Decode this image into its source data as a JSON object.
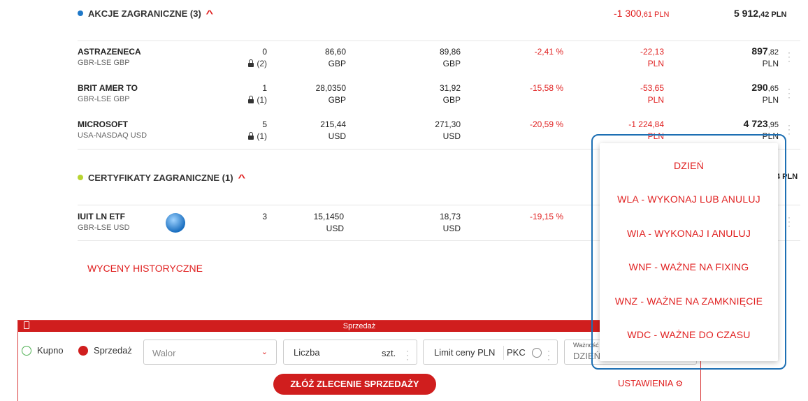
{
  "sections": {
    "foreign_stocks": {
      "title": "AKCJE ZAGRANICZNE (3)",
      "profit_main": "-1 300",
      "profit_dec": ",61 PLN",
      "value_main": "5 912",
      "value_dec": ",42 PLN",
      "dot_color": "#1e78c8"
    },
    "foreign_certs": {
      "title": "CERTYFIKATY ZAGRANICZNE (1)",
      "value_partial": "4 PLN",
      "dot_color": "#b8d430"
    }
  },
  "rows": [
    {
      "name": "ASTRAZENECA",
      "market": "GBR-LSE GBP",
      "qty": "0",
      "blocked": "(2)",
      "price": "86,60",
      "price_cur": "GBP",
      "cur_price": "89,86",
      "cur_cur": "GBP",
      "pct": "-2,41 %",
      "pl": "-22,13",
      "pl_cur": "PLN",
      "val_main": "897",
      "val_dec": ",82",
      "val_cur": "PLN"
    },
    {
      "name": "BRIT AMER TO",
      "market": "GBR-LSE GBP",
      "qty": "1",
      "blocked": "(1)",
      "price": "28,0350",
      "price_cur": "GBP",
      "cur_price": "31,92",
      "cur_cur": "GBP",
      "pct": "-15,58 %",
      "pl": "-53,65",
      "pl_cur": "PLN",
      "val_main": "290",
      "val_dec": ",65",
      "val_cur": "PLN"
    },
    {
      "name": "MICROSOFT",
      "market": "USA-NASDAQ USD",
      "qty": "5",
      "blocked": "(1)",
      "price": "215,44",
      "price_cur": "USD",
      "cur_price": "271,30",
      "cur_cur": "USD",
      "pct": "-20,59 %",
      "pl": "-1 224,84",
      "pl_cur": "PLN",
      "val_main": "4 723",
      "val_dec": ",95",
      "val_cur": "PLN"
    }
  ],
  "cert_row": {
    "name": "IUIT LN ETF",
    "market": "GBR-LSE USD",
    "qty": "3",
    "price": "15,1450",
    "price_cur": "USD",
    "cur_price": "18,73",
    "cur_cur": "USD",
    "pct": "-19,15 %"
  },
  "historical_link": "WYCENY HISTORYCZNE",
  "order_panel": {
    "title": "Sprzedaż",
    "buy_label": "Kupno",
    "sell_label": "Sprzedaż",
    "instrument_placeholder": "Walor",
    "quantity_placeholder": "Liczba",
    "quantity_unit": "szt.",
    "limit_label": "Limit ceny PLN",
    "pkc_label": "PKC",
    "validity_label": "Ważność",
    "validity_value": "DZIEŃ",
    "submit_label": "ZŁÓŻ ZLECENIE SPRZEDAŻY",
    "settings_label": "USTAWIENIA"
  },
  "validity_options": [
    "DZIEŃ",
    "WLA - WYKONAJ LUB ANULUJ",
    "WIA - WYKONAJ I ANULUJ",
    "WNF - WAŻNE NA FIXING",
    "WNZ - WAŻNE NA ZAMKNIĘCIE",
    "WDC - WAŻNE DO CZASU"
  ],
  "colors": {
    "accent": "#e02020",
    "panel_header": "#d01e1e",
    "highlight": "#1d6fb3",
    "buy_radio": "#4caf50"
  }
}
